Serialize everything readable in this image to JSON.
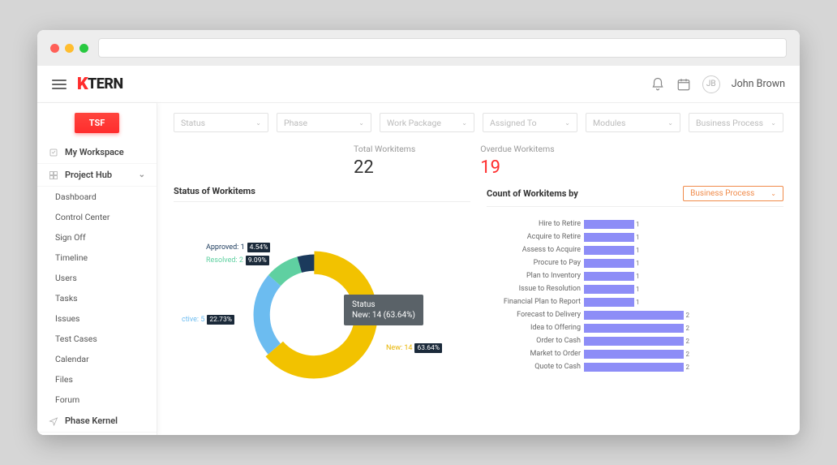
{
  "logo": {
    "brand": "TERN"
  },
  "user": {
    "name": "John Brown"
  },
  "sidebar": {
    "tsf": "TSF",
    "workspace": "My Workspace",
    "hub": "Project Hub",
    "items": [
      "Dashboard",
      "Control Center",
      "Sign Off",
      "Timeline",
      "Users",
      "Tasks",
      "Issues",
      "Test Cases",
      "Calendar",
      "Files",
      "Forum"
    ],
    "kernel": "Phase Kernel"
  },
  "filters": [
    "Status",
    "Phase",
    "Work Package",
    "Assigned To",
    "Modules",
    "Business Process"
  ],
  "stats": {
    "total_label": "Total Workitems",
    "total_value": "22",
    "overdue_label": "Overdue Workitems",
    "overdue_value": "19"
  },
  "left_panel": {
    "title": "Status of Workitems"
  },
  "right_panel": {
    "title": "Count of Workitems by",
    "select": "Business Process"
  },
  "chart_data": {
    "donut": {
      "type": "pie",
      "title": "Status of Workitems",
      "total": 22,
      "series": [
        {
          "name": "New",
          "value": 14,
          "percent": 63.64,
          "color": "#f2c200"
        },
        {
          "name": "Active",
          "value": 5,
          "percent": 22.73,
          "color": "#6cbcf0"
        },
        {
          "name": "Resolved",
          "value": 2,
          "percent": 9.09,
          "color": "#5fd0a1"
        },
        {
          "name": "Approved",
          "value": 1,
          "percent": 4.54,
          "color": "#1b3a5c"
        }
      ],
      "tooltip": {
        "heading": "Status",
        "line": "New: 14 (63.64%)"
      }
    },
    "bars": {
      "type": "bar",
      "title": "Count of Workitems by Business Process",
      "xlim": [
        0,
        4
      ],
      "categories": [
        "Hire to Retire",
        "Acquire to Retire",
        "Assess to Acquire",
        "Procure to Pay",
        "Plan to Inventory",
        "Issue to Resolution",
        "Financial Plan to Report",
        "Forecast to Delivery",
        "Idea to Offering",
        "Order to Cash",
        "Market to Order",
        "Quote to Cash"
      ],
      "values": [
        1,
        1,
        1,
        1,
        1,
        1,
        1,
        2,
        2,
        2,
        2,
        2
      ]
    }
  },
  "donut_labels": {
    "approved": "Approved: 1",
    "approved_pct": "4.54%",
    "resolved": "Resolved: 2",
    "resolved_pct": "9.09%",
    "active": "ctive: 5",
    "active_pct": "22.73%",
    "new": "New: 14",
    "new_pct": "63.64%"
  }
}
